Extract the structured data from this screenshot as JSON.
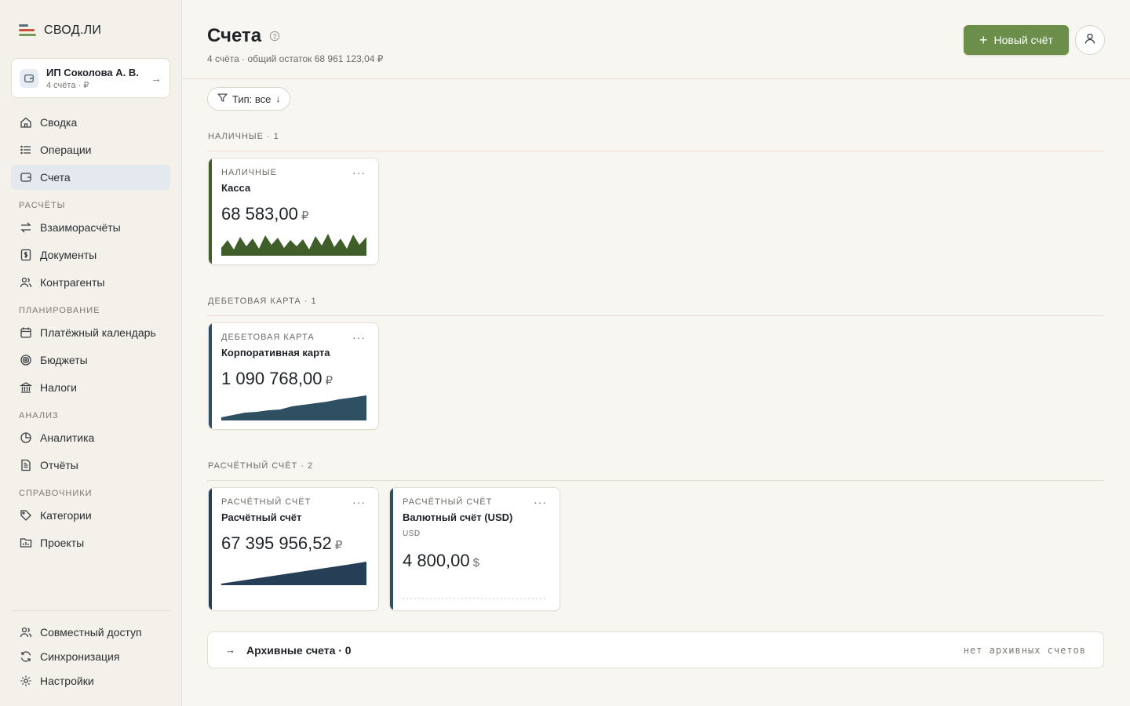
{
  "app": {
    "logo_text": "СВОД.ЛИ"
  },
  "org": {
    "name": "ИП Соколова А. В.",
    "sub": "4 счёта · ₽"
  },
  "nav": {
    "main": [
      {
        "label": "Сводка",
        "icon": "home-icon"
      },
      {
        "label": "Операции",
        "icon": "list-icon"
      },
      {
        "label": "Счета",
        "icon": "wallet-icon",
        "active": true
      }
    ],
    "sections": [
      {
        "title": "РАСЧЁТЫ",
        "items": [
          {
            "label": "Взаиморасчёты",
            "icon": "exchange-icon"
          },
          {
            "label": "Документы",
            "icon": "document-dollar-icon"
          },
          {
            "label": "Контрагенты",
            "icon": "users-icon"
          }
        ]
      },
      {
        "title": "ПЛАНИРОВАНИЕ",
        "items": [
          {
            "label": "Платёжный календарь",
            "icon": "calendar-icon"
          },
          {
            "label": "Бюджеты",
            "icon": "target-icon"
          },
          {
            "label": "Налоги",
            "icon": "bank-icon"
          }
        ]
      },
      {
        "title": "АНАЛИЗ",
        "items": [
          {
            "label": "Аналитика",
            "icon": "pie-chart-icon"
          },
          {
            "label": "Отчёты",
            "icon": "report-icon"
          }
        ]
      },
      {
        "title": "СПРАВОЧНИКИ",
        "items": [
          {
            "label": "Категории",
            "icon": "tag-icon"
          },
          {
            "label": "Проекты",
            "icon": "folder-chart-icon"
          }
        ]
      }
    ],
    "bottom": [
      {
        "label": "Совместный доступ",
        "icon": "users-icon"
      },
      {
        "label": "Синхронизация",
        "icon": "sync-icon"
      },
      {
        "label": "Настройки",
        "icon": "gear-icon"
      }
    ]
  },
  "header": {
    "title": "Счета",
    "subtitle": "4 счёта · общий остаток 68 961 123,04 ₽",
    "new_button": "Новый счёт"
  },
  "filter": {
    "label": "Тип: все"
  },
  "groups": [
    {
      "title": "НАЛИЧНЫЕ · 1",
      "accounts": [
        {
          "type": "НАЛИЧНЫЕ",
          "name": "Касса",
          "currency_code": "",
          "balance": "68 583,00",
          "currency_symbol": "₽",
          "color": "#3f5e2a",
          "spark": "volatile"
        }
      ]
    },
    {
      "title": "ДЕБЕТОВАЯ КАРТА · 1",
      "accounts": [
        {
          "type": "ДЕБЕТОВАЯ КАРТА",
          "name": "Корпоративная карта",
          "currency_code": "",
          "balance": "1 090 768,00",
          "currency_symbol": "₽",
          "color": "#2f4f63",
          "spark": "rising"
        }
      ]
    },
    {
      "title": "РАСЧЁТНЫЙ СЧЁТ · 2",
      "accounts": [
        {
          "type": "РАСЧЁТНЫЙ СЧЁТ",
          "name": "Расчётный счёт",
          "currency_code": "",
          "balance": "67 395 956,52",
          "currency_symbol": "₽",
          "color": "#263f56",
          "spark": "rising-steady"
        },
        {
          "type": "РАСЧЁТНЫЙ СЧЁТ",
          "name": "Валютный счёт (USD)",
          "currency_code": "USD",
          "balance": "4 800,00",
          "currency_symbol": "$",
          "color": "#2f4f63",
          "spark": "flat"
        }
      ]
    }
  ],
  "archive": {
    "title": "Архивные счета · 0",
    "note": "нет архивных счетов"
  },
  "colors": {
    "accent": "#6b8f4a",
    "active_nav_bg": "#e3e9ee"
  }
}
